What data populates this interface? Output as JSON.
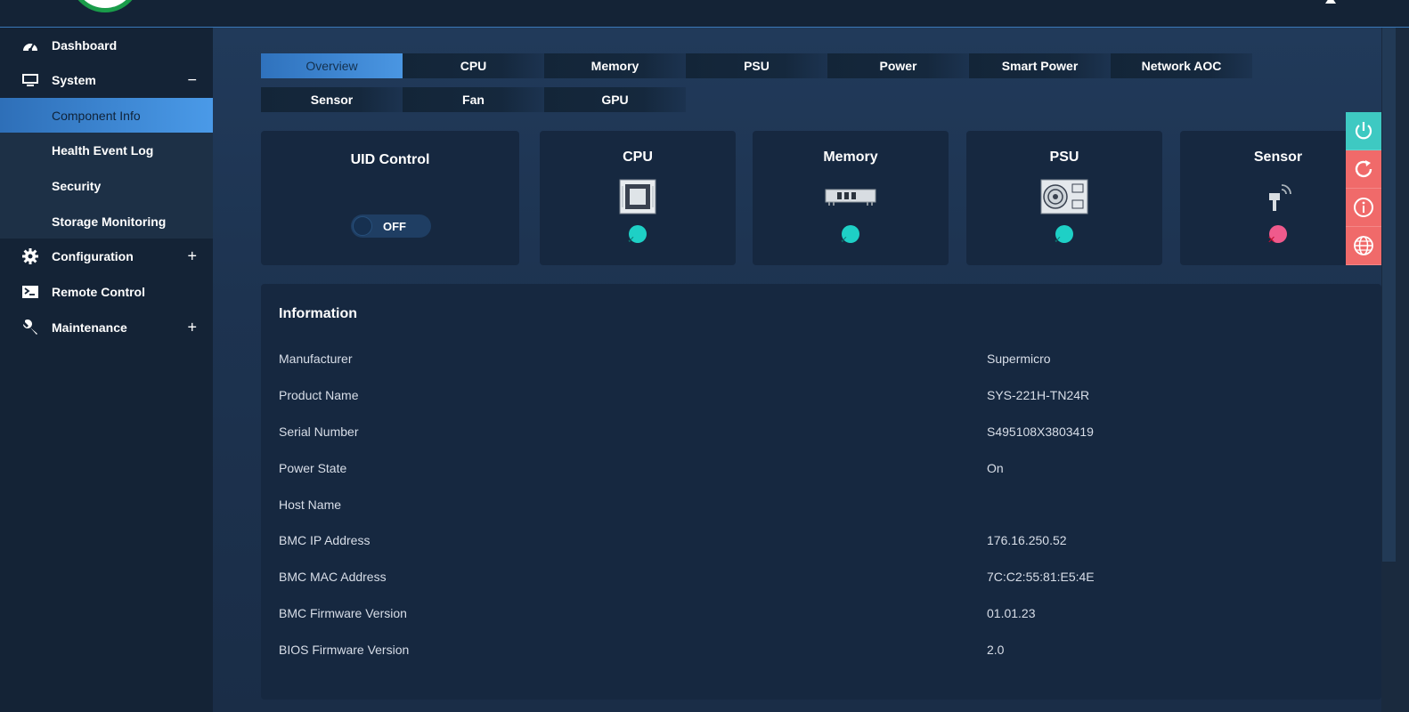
{
  "header": {
    "logo_name": "supermicro-logo",
    "user_icon": "user-icon"
  },
  "sidebar": {
    "items": [
      {
        "label": "Dashboard",
        "icon": "gauge-icon"
      },
      {
        "label": "System",
        "icon": "monitor-icon",
        "toggle": "−"
      },
      {
        "label": "Configuration",
        "icon": "gear-icon",
        "toggle": "+"
      },
      {
        "label": "Remote Control",
        "icon": "terminal-icon"
      },
      {
        "label": "Maintenance",
        "icon": "wrench-icon",
        "toggle": "+"
      }
    ],
    "system_sub": [
      {
        "label": "Component Info",
        "active": true
      },
      {
        "label": "Health Event Log"
      },
      {
        "label": "Security"
      },
      {
        "label": "Storage Monitoring"
      }
    ]
  },
  "tabs": {
    "row1": [
      "Overview",
      "CPU",
      "Memory",
      "PSU",
      "Power",
      "Smart Power",
      "Network AOC"
    ],
    "row2": [
      "Sensor",
      "Fan",
      "GPU"
    ],
    "active": "Overview"
  },
  "cards": {
    "uid": {
      "title": "UID Control",
      "state": "OFF"
    },
    "cpu": {
      "title": "CPU",
      "status": "ok",
      "icon": "cpu-chip-icon"
    },
    "memory": {
      "title": "Memory",
      "status": "ok",
      "icon": "memory-module-icon"
    },
    "psu": {
      "title": "PSU",
      "status": "ok",
      "icon": "power-supply-icon"
    },
    "sensor": {
      "title": "Sensor",
      "status": "error",
      "icon": "sensor-icon"
    }
  },
  "side_actions": [
    {
      "icon": "power-icon",
      "color": "#3ec9c2"
    },
    {
      "icon": "refresh-icon",
      "color": "#f06a6a"
    },
    {
      "icon": "info-icon",
      "color": "#f06a6a"
    },
    {
      "icon": "globe-icon",
      "color": "#f06a6a"
    }
  ],
  "information": {
    "title": "Information",
    "rows": [
      {
        "key": "Manufacturer",
        "value": "Supermicro"
      },
      {
        "key": "Product Name",
        "value": "SYS-221H-TN24R"
      },
      {
        "key": "Serial Number",
        "value": "S495108X3803419"
      },
      {
        "key": "Power State",
        "value": "On"
      },
      {
        "key": "Host Name",
        "value": ""
      },
      {
        "key": "BMC IP Address",
        "value": "176.16.250.52"
      },
      {
        "key": "BMC MAC Address",
        "value": "7C:C2:55:81:E5:4E"
      },
      {
        "key": "BMC Firmware Version",
        "value": "01.01.23"
      },
      {
        "key": "BIOS Firmware Version",
        "value": "2.0"
      }
    ]
  },
  "colors": {
    "accent": "#4a96e2",
    "ok": "#1ed0c6",
    "error": "#ef5a8c",
    "panel": "#162840"
  }
}
